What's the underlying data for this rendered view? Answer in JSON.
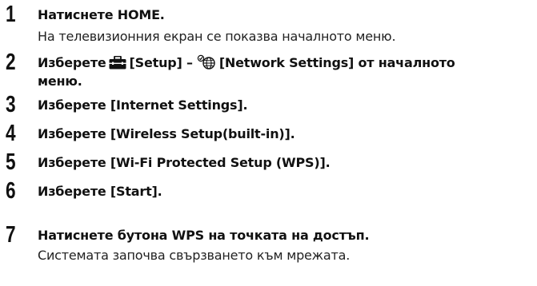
{
  "steps": [
    {
      "number": "1",
      "instruction": "Натиснете HOME.",
      "description": "На телевизионния екран се показва началното меню."
    },
    {
      "number": "2",
      "prefix": "Изберете",
      "menu_setup": "[Setup] –",
      "menu_network": "[Network Settings] от началното",
      "instruction_cont": "меню.",
      "icon_setup": "toolbox-icon",
      "icon_network": "globe-network-icon"
    },
    {
      "number": "3",
      "instruction": "Изберете [Internet Settings]."
    },
    {
      "number": "4",
      "instruction": "Изберете [Wireless Setup(built-in)]."
    },
    {
      "number": "5",
      "instruction": "Изберете [Wi-Fi Protected Setup (WPS)]."
    },
    {
      "number": "6",
      "instruction": "Изберете [Start]."
    },
    {
      "number": "7",
      "instruction": "Натиснете бутона WPS на точката на достъп.",
      "description": "Системата започва свързването към мрежата."
    }
  ]
}
